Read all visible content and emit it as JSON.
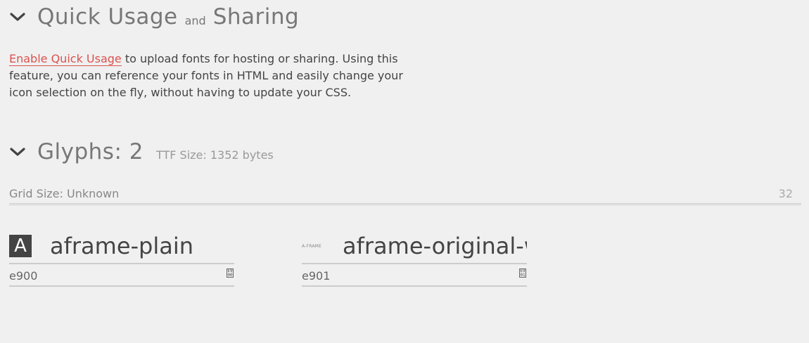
{
  "quick_usage": {
    "title_part1": "Quick Usage",
    "title_connector": "and",
    "title_part2": "Sharing",
    "link_text": "Enable Quick Usage",
    "description": " to upload fonts for hosting or sharing. Using this feature, you can reference your fonts in HTML and easily change your icon selection on the fly, without having to update your CSS."
  },
  "glyphs": {
    "title": "Glyphs: 2",
    "ttf_size": "TTF Size: 1352 bytes",
    "grid_label": "Grid Size: Unknown",
    "grid_value": "32",
    "items": [
      {
        "icon_text": "A",
        "name": "aframe-plain",
        "code": "e900",
        "code_icon_top": "E9",
        "code_icon_bottom": "00"
      },
      {
        "icon_text": "A-FRAME",
        "name": "aframe-original-wordmark",
        "code": "e901",
        "code_icon_top": "E9",
        "code_icon_bottom": "01"
      }
    ]
  },
  "icons": {
    "collapse_quick_usage": "chevron-down-icon",
    "collapse_glyphs": "chevron-down-icon",
    "codepoint_glyph": "codepoint-box-icon"
  }
}
